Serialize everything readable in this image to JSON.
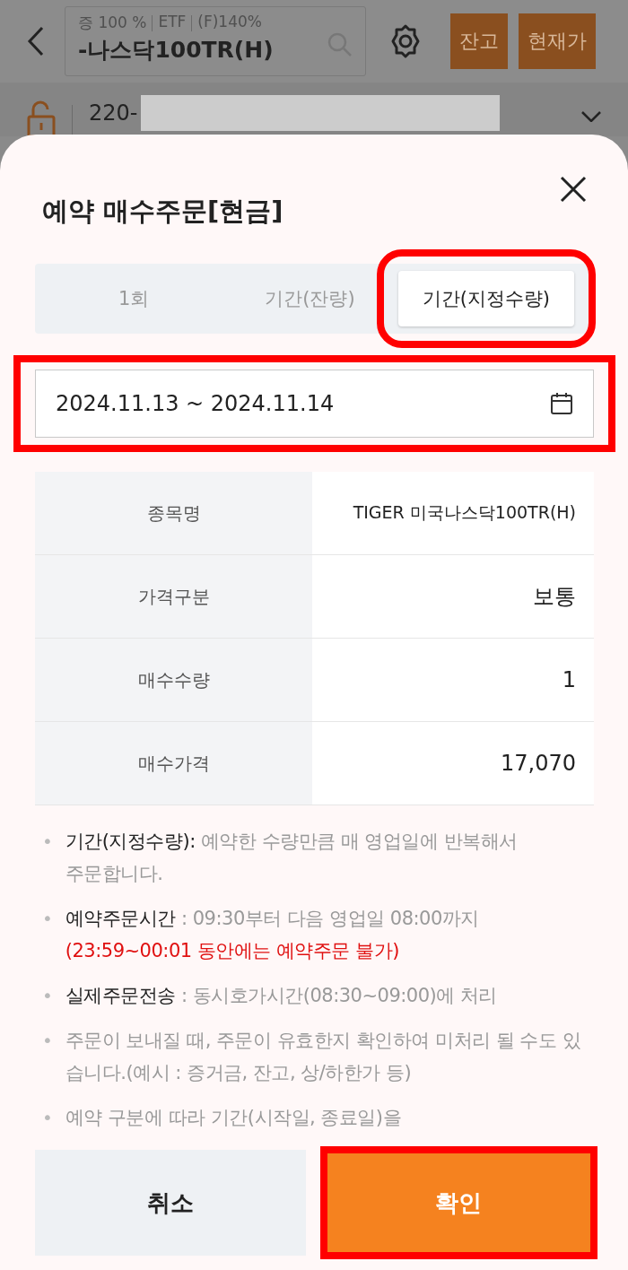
{
  "header": {
    "margin_info": [
      "증 100 %",
      "ETF",
      "(F)140%"
    ],
    "stock_name": "-나스닥100TR(H)",
    "buttons": [
      "잔고",
      "현재가"
    ]
  },
  "account": {
    "number": "220-"
  },
  "sheet": {
    "title": "예약 매수주문[현금]",
    "tabs": [
      {
        "label": "1회",
        "selected": false,
        "highlighted": false
      },
      {
        "label": "기간(잔량)",
        "selected": false,
        "highlighted": false
      },
      {
        "label": "기간(지정수량)",
        "selected": true,
        "highlighted": true
      }
    ],
    "date_range": {
      "value": "2024.11.13 ~ 2024.11.14",
      "highlighted": true
    },
    "rows": [
      {
        "label": "종목명",
        "value": "TIGER 미국나스닥100TR(H)",
        "emphasis": false
      },
      {
        "label": "가격구분",
        "value": "보통",
        "emphasis": true
      },
      {
        "label": "매수수량",
        "value": "1",
        "emphasis": true
      },
      {
        "label": "매수가격",
        "value": "17,070",
        "emphasis": true
      }
    ],
    "notes": [
      {
        "bullet": "•",
        "label": "기간(지정수량):",
        "text": "예약한 수량만큼 매 영업일에 반복해서 주문합니다."
      },
      {
        "bullet": "•",
        "label": "예약주문시간",
        "text": ": 09:30부터 다음 영업일 08:00까지",
        "warning": "(23:59~00:01 동안에는 예약주문 불가)"
      },
      {
        "bullet": "•",
        "label": "실제주문전송",
        "text": ": 동시호가시간(08:30~09:00)에 처리"
      },
      {
        "bullet": "•",
        "text": "주문이 보내질 때, 주문이 유효한지 확인하여 미처리 될 수도 있습니다.(예시 : 증거금, 잔고, 상/하한가 등)"
      },
      {
        "bullet": "•",
        "text": "예약 구분에 따라 기간(시작일, 종료일)을"
      }
    ],
    "actions": [
      {
        "label": "취소",
        "kind": "secondary",
        "highlighted": false
      },
      {
        "label": "확인",
        "kind": "primary",
        "highlighted": true
      }
    ]
  }
}
